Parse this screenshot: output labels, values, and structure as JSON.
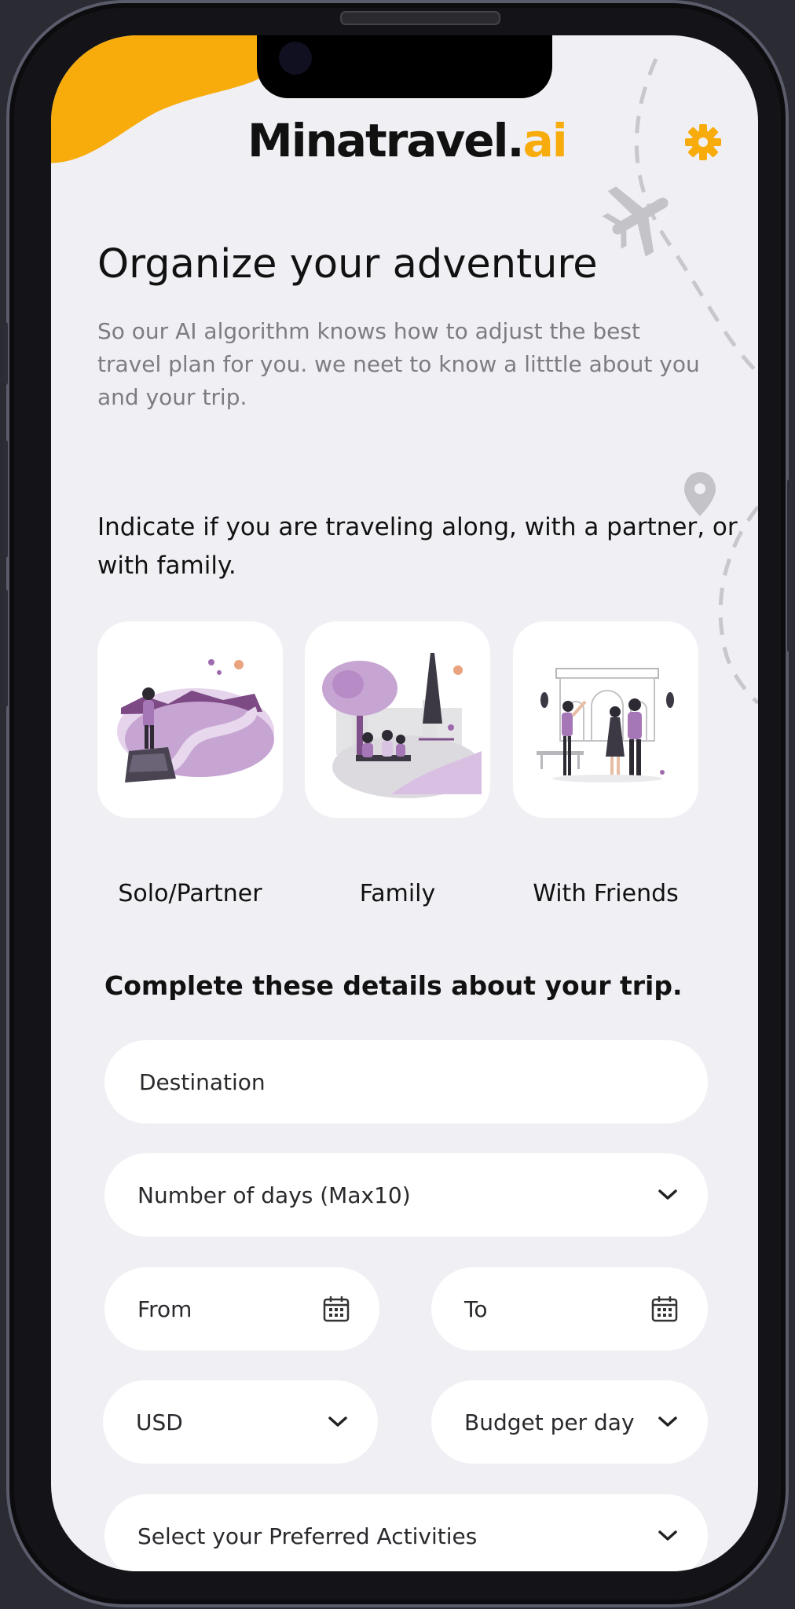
{
  "brand": {
    "logo_main": "Minatravel.",
    "logo_accent": "ai",
    "accent_color": "#f8ac0b"
  },
  "header": {
    "settings_icon": "gear-icon"
  },
  "intro": {
    "title": "Organize your adventure",
    "subtitle": "So our AI algorithm knows how to adjust the best travel plan for you. we neet to know a litttle about you and your trip."
  },
  "travel_type": {
    "question": "Indicate if you are traveling along, with a partner, or with family.",
    "options": [
      {
        "label": "Solo/Partner",
        "illustration": "hiker-on-cliff-illustration"
      },
      {
        "label": "Family",
        "illustration": "family-in-park-illustration"
      },
      {
        "label": "With Friends",
        "illustration": "friends-at-monument-illustration"
      }
    ]
  },
  "trip_details": {
    "heading": "Complete these details about your trip.",
    "destination": {
      "placeholder": "Destination",
      "value": ""
    },
    "days": {
      "label": "Number of days (Max10)",
      "icon": "chevron-down-icon"
    },
    "from": {
      "label": "From",
      "icon": "calendar-icon"
    },
    "to": {
      "label": "To",
      "icon": "calendar-icon"
    },
    "currency": {
      "label": "USD",
      "icon": "chevron-down-icon"
    },
    "budget": {
      "label": "Budget per day",
      "icon": "chevron-down-icon"
    },
    "activities": {
      "label": "Select your Preferred Activities",
      "icon": "chevron-down-icon"
    }
  }
}
